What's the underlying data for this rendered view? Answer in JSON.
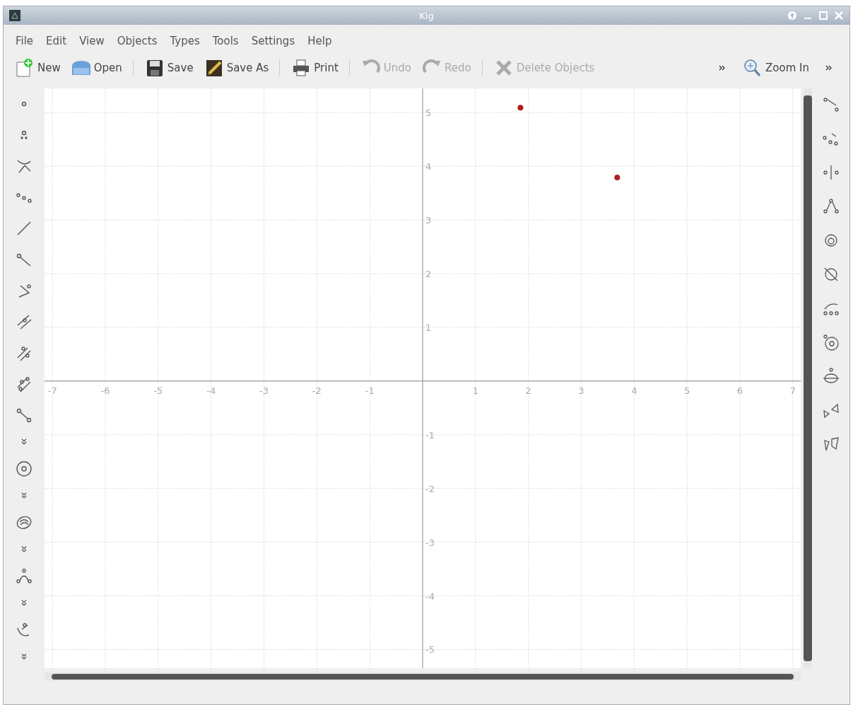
{
  "window": {
    "title": "Kig"
  },
  "menu": [
    {
      "label": "File"
    },
    {
      "label": "Edit"
    },
    {
      "label": "View"
    },
    {
      "label": "Objects"
    },
    {
      "label": "Types"
    },
    {
      "label": "Tools"
    },
    {
      "label": "Settings"
    },
    {
      "label": "Help"
    }
  ],
  "toolbar": [
    {
      "kind": "button",
      "label": "New",
      "disabled": false
    },
    {
      "kind": "button",
      "label": "Open",
      "disabled": false
    },
    {
      "kind": "separator"
    },
    {
      "kind": "button",
      "label": "Save",
      "disabled": false
    },
    {
      "kind": "button",
      "label": "Save As",
      "disabled": false
    },
    {
      "kind": "separator"
    },
    {
      "kind": "button",
      "label": "Print",
      "disabled": false
    },
    {
      "kind": "separator"
    },
    {
      "kind": "button",
      "label": "Undo",
      "disabled": true
    },
    {
      "kind": "button",
      "label": "Redo",
      "disabled": true
    },
    {
      "kind": "separator"
    },
    {
      "kind": "button",
      "label": "Delete Objects",
      "disabled": true
    },
    {
      "kind": "overflow"
    },
    {
      "kind": "button",
      "label": "Zoom In",
      "disabled": false
    },
    {
      "kind": "overflow"
    }
  ],
  "canvas": {
    "chart_data": {
      "type": "scatter",
      "grid": true,
      "xlim": [
        -7.15,
        7.15
      ],
      "ylim": [
        -5.35,
        5.45
      ],
      "xticks": [
        -7,
        -6,
        -5,
        -4,
        -3,
        -2,
        -1,
        1,
        2,
        3,
        4,
        5,
        6,
        7
      ],
      "yticks": [
        -5,
        -4,
        -3,
        -2,
        -1,
        1,
        2,
        3,
        4,
        5
      ],
      "x": [
        1.85,
        3.68
      ],
      "series": [
        {
          "color": "#b01c1c",
          "values": [
            5.09,
            3.79
          ]
        }
      ]
    }
  }
}
